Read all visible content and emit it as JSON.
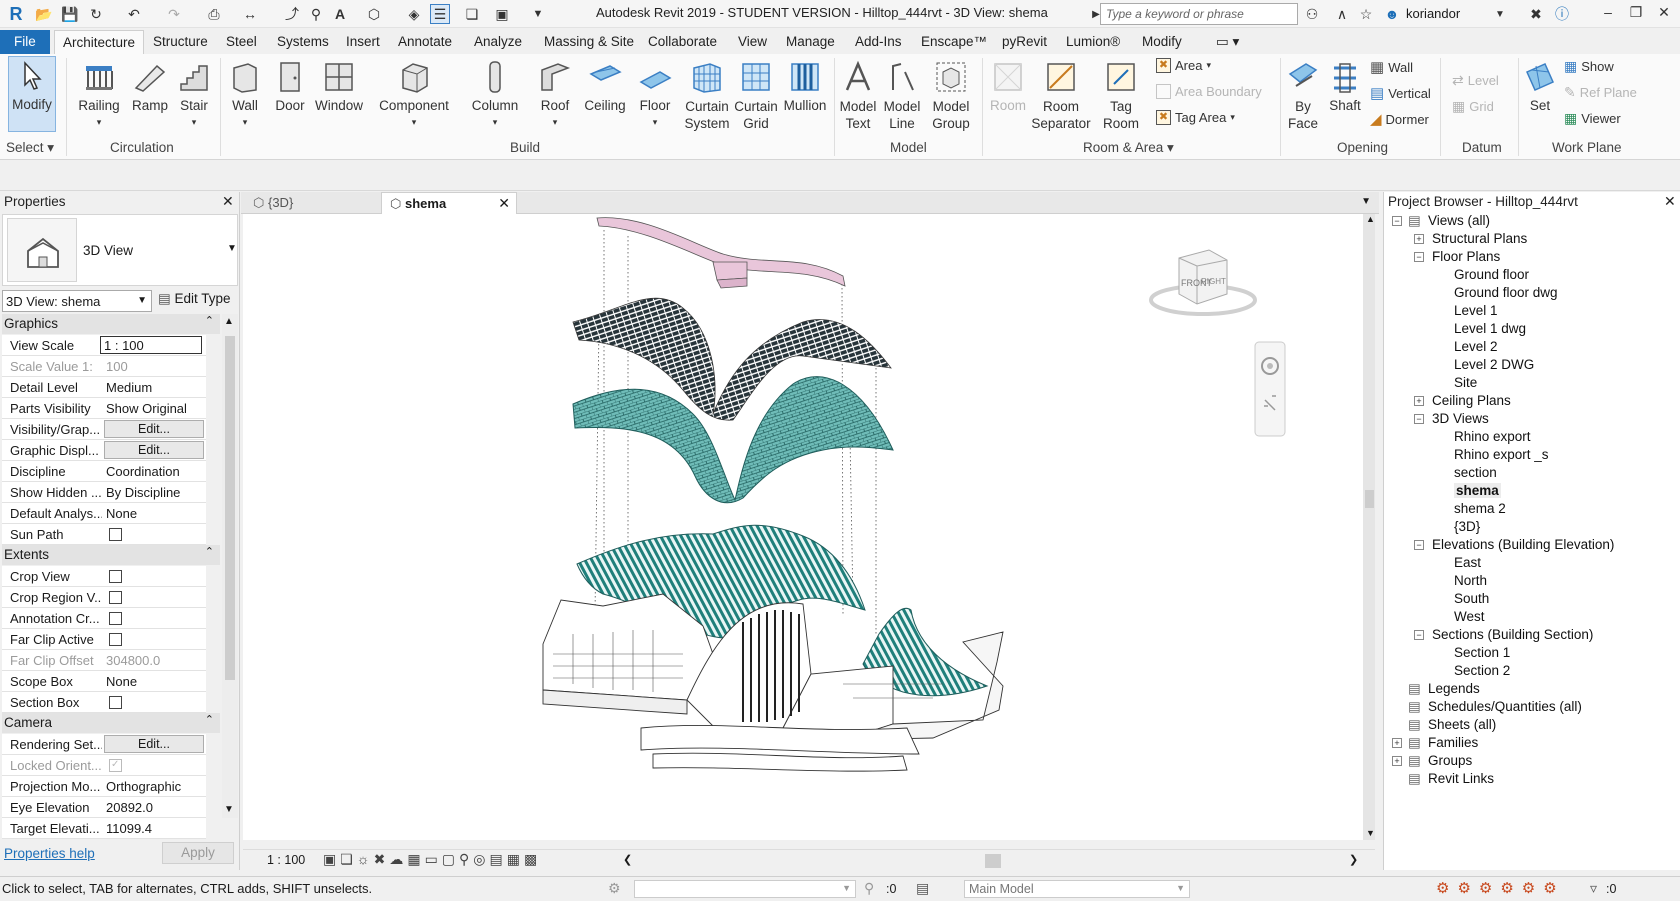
{
  "titlebar": {
    "title": "Autodesk Revit 2019 - STUDENT VERSION - Hilltop_444rvt - 3D View: shema",
    "search_placeholder": "Type a keyword or phrase",
    "user": "koriandor"
  },
  "ribbon_tabs": [
    "File",
    "Architecture",
    "Structure",
    "Steel",
    "Systems",
    "Insert",
    "Annotate",
    "Analyze",
    "Massing & Site",
    "Collaborate",
    "View",
    "Manage",
    "Add-Ins",
    "Enscape™",
    "pyRevit",
    "Lumion®",
    "Modify"
  ],
  "ribbon": {
    "select": {
      "modify": "Modify",
      "group": "Select"
    },
    "circulation": {
      "items": [
        "Railing",
        "Ramp",
        "Stair"
      ],
      "group": "Circulation"
    },
    "build": {
      "items": [
        "Wall",
        "Door",
        "Window",
        "Component",
        "Column",
        "Roof",
        "Ceiling",
        "Floor"
      ],
      "curtain_system": [
        "Curtain",
        "System"
      ],
      "curtain_grid": [
        "Curtain",
        "Grid"
      ],
      "mullion": "Mullion",
      "group": "Build"
    },
    "model": {
      "text": [
        "Model",
        "Text"
      ],
      "line": [
        "Model",
        "Line"
      ],
      "group_btn": [
        "Model",
        "Group"
      ],
      "group": "Model"
    },
    "room_area": {
      "room": "Room",
      "separator": [
        "Room",
        "Separator"
      ],
      "tag_room": [
        "Tag",
        "Room"
      ],
      "area": "Area",
      "area_boundary": "Area  Boundary",
      "tag_area": "Tag  Area",
      "group": "Room & Area"
    },
    "opening": {
      "by_face": [
        "By",
        "Face"
      ],
      "shaft": "Shaft",
      "wall": "Wall",
      "vertical": "Vertical",
      "dormer": "Dormer",
      "group": "Opening"
    },
    "datum": {
      "level": "Level",
      "grid": "Grid",
      "group": "Datum"
    },
    "work_plane": {
      "set": "Set",
      "show": "Show",
      "ref_plane": "Ref  Plane",
      "viewer": "Viewer",
      "group": "Work Plane"
    }
  },
  "properties": {
    "title": "Properties",
    "type_name": "3D View",
    "view_selector": "3D View: shema",
    "edit_type": "Edit Type",
    "graphics_section": "Graphics",
    "graphics": [
      {
        "k": "View Scale",
        "v": "1 : 100",
        "kind": "input"
      },
      {
        "k": "Scale Value    1:",
        "v": "100",
        "kind": "grey"
      },
      {
        "k": "Detail Level",
        "v": "Medium"
      },
      {
        "k": "Parts Visibility",
        "v": "Show Original"
      },
      {
        "k": "Visibility/Grap...",
        "v": "Edit...",
        "kind": "btn"
      },
      {
        "k": "Graphic Displ...",
        "v": "Edit...",
        "kind": "btn"
      },
      {
        "k": "Discipline",
        "v": "Coordination"
      },
      {
        "k": "Show Hidden ...",
        "v": "By Discipline"
      },
      {
        "k": "Default Analys...",
        "v": "None"
      },
      {
        "k": "Sun Path",
        "v": "",
        "kind": "chk"
      }
    ],
    "extents_section": "Extents",
    "extents": [
      {
        "k": "Crop View",
        "v": "",
        "kind": "chk"
      },
      {
        "k": "Crop Region V...",
        "v": "",
        "kind": "chk"
      },
      {
        "k": "Annotation Cr...",
        "v": "",
        "kind": "chk"
      },
      {
        "k": "Far Clip Active",
        "v": "",
        "kind": "chk"
      },
      {
        "k": "Far Clip Offset",
        "v": "304800.0",
        "kind": "grey"
      },
      {
        "k": "Scope Box",
        "v": "None"
      },
      {
        "k": "Section Box",
        "v": "",
        "kind": "chk"
      }
    ],
    "camera_section": "Camera",
    "camera": [
      {
        "k": "Rendering Set...",
        "v": "Edit...",
        "kind": "btn"
      },
      {
        "k": "Locked Orient...",
        "v": "",
        "kind": "chkgrey"
      },
      {
        "k": "Projection Mo...",
        "v": "Orthographic"
      },
      {
        "k": "Eye Elevation",
        "v": "20892.0"
      },
      {
        "k": "Target Elevati...",
        "v": "11099.4"
      }
    ],
    "help": "Properties help",
    "apply": "Apply"
  },
  "view_tabs": [
    {
      "label": "{3D}",
      "active": false
    },
    {
      "label": "shema",
      "active": true
    }
  ],
  "view_control": {
    "scale": "1 : 100"
  },
  "viewcube": {
    "front": "FRONT",
    "right": "RIGHT"
  },
  "browser": {
    "title": "Project Browser - Hilltop_444rvt",
    "tree": [
      {
        "label": "Views (all)",
        "level": 0,
        "box": "-"
      },
      {
        "label": "Structural Plans",
        "level": 1,
        "box": "+"
      },
      {
        "label": "Floor Plans",
        "level": 1,
        "box": "-"
      },
      {
        "label": "Ground floor",
        "level": 2
      },
      {
        "label": "Ground floor dwg",
        "level": 2
      },
      {
        "label": "Level 1",
        "level": 2
      },
      {
        "label": "Level 1 dwg",
        "level": 2
      },
      {
        "label": "Level 2",
        "level": 2
      },
      {
        "label": "Level 2 DWG",
        "level": 2
      },
      {
        "label": "Site",
        "level": 2
      },
      {
        "label": "Ceiling Plans",
        "level": 1,
        "box": "+"
      },
      {
        "label": "3D Views",
        "level": 1,
        "box": "-"
      },
      {
        "label": "Rhino export",
        "level": 2
      },
      {
        "label": "Rhino export _s",
        "level": 2
      },
      {
        "label": "section",
        "level": 2
      },
      {
        "label": "shema",
        "level": 2,
        "bold": true
      },
      {
        "label": "shema 2",
        "level": 2
      },
      {
        "label": "{3D}",
        "level": 2
      },
      {
        "label": "Elevations (Building Elevation)",
        "level": 1,
        "box": "-"
      },
      {
        "label": "East",
        "level": 2
      },
      {
        "label": "North",
        "level": 2
      },
      {
        "label": "South",
        "level": 2
      },
      {
        "label": "West",
        "level": 2
      },
      {
        "label": "Sections (Building Section)",
        "level": 1,
        "box": "-"
      },
      {
        "label": "Section 1",
        "level": 2
      },
      {
        "label": "Section 2",
        "level": 2
      },
      {
        "label": "Legends",
        "level": 0
      },
      {
        "label": "Schedules/Quantities (all)",
        "level": 0
      },
      {
        "label": "Sheets (all)",
        "level": 0
      },
      {
        "label": "Families",
        "level": 0,
        "box": "+"
      },
      {
        "label": "Groups",
        "level": 0,
        "box": "+"
      },
      {
        "label": "Revit Links",
        "level": 0
      }
    ]
  },
  "status": {
    "message": "Click to select, TAB for alternates, CTRL adds, SHIFT unselects.",
    "workset_count": ":0",
    "model": "Main Model",
    "filter_count": ":0"
  },
  "colors": {
    "accent": "#1e6fb8",
    "teal": "#2e8e8c",
    "roof_pink": "#e9c6da"
  }
}
